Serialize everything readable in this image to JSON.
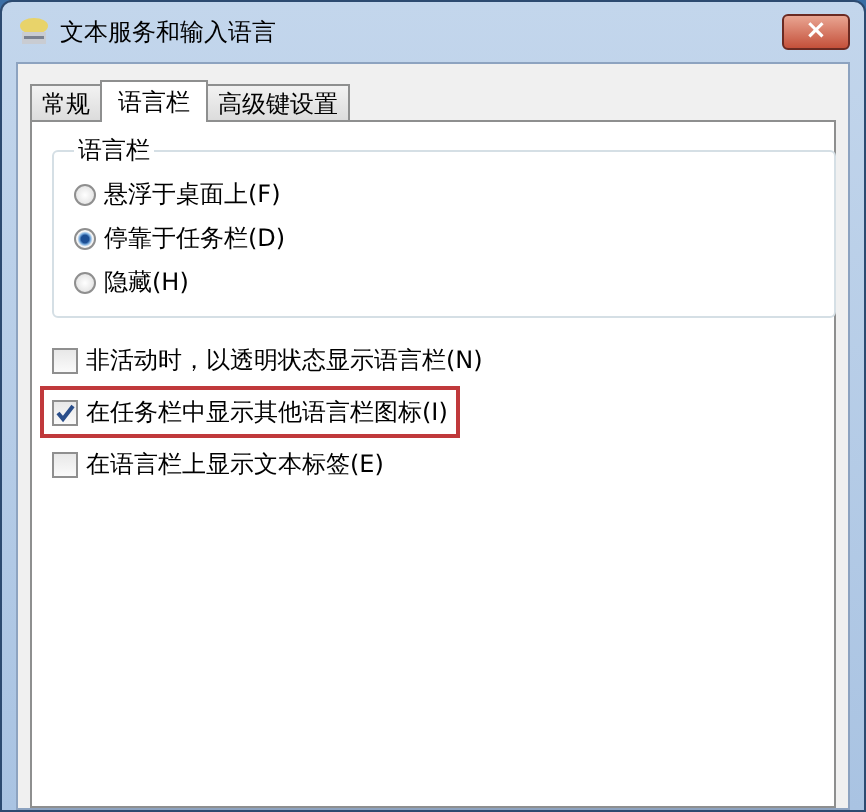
{
  "window": {
    "title": "文本服务和输入语言",
    "close": "×"
  },
  "tabs": [
    {
      "label": "常规",
      "selected": false
    },
    {
      "label": "语言栏",
      "selected": true
    },
    {
      "label": "高级键设置",
      "selected": false
    }
  ],
  "group": {
    "title": "语言栏",
    "options": [
      {
        "label": "悬浮于桌面上(F)",
        "selected": false
      },
      {
        "label": "停靠于任务栏(D)",
        "selected": true
      },
      {
        "label": "隐藏(H)",
        "selected": false
      }
    ]
  },
  "checkboxes": [
    {
      "label": "非活动时，以透明状态显示语言栏(N)",
      "checked": false,
      "highlighted": false
    },
    {
      "label": "在任务栏中显示其他语言栏图标(I)",
      "checked": true,
      "highlighted": true
    },
    {
      "label": "在语言栏上显示文本标签(E)",
      "checked": false,
      "highlighted": false
    }
  ]
}
